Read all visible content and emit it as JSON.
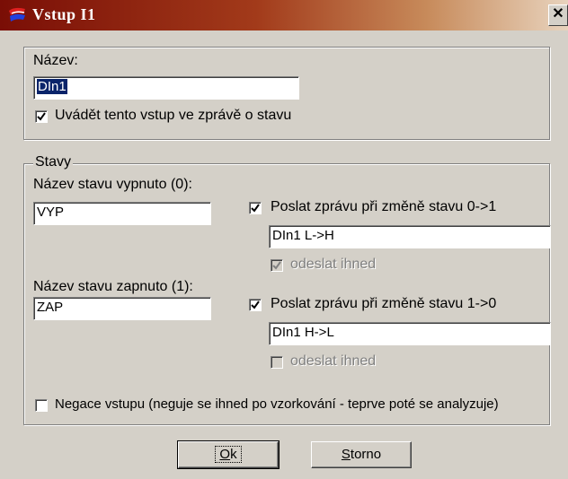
{
  "window": {
    "title": "Vstup I1",
    "close_glyph": "✕"
  },
  "name_section": {
    "label": "Název:",
    "value": "DIn1",
    "report_checkbox": {
      "label": "Uvádět tento vstup ve zprávě o stavu",
      "checked": true
    }
  },
  "states": {
    "legend": "Stavy",
    "off": {
      "label": "Název stavu vypnuto (0):",
      "value": "VYP",
      "send": {
        "label": "Poslat zprávu při změně stavu 0->1",
        "checked": true
      },
      "message": "DIn1 L->H",
      "immediate": {
        "label": "odeslat ihned",
        "checked": true,
        "disabled": true
      }
    },
    "on": {
      "label": "Název stavu zapnuto (1):",
      "value": "ZAP",
      "send": {
        "label": "Poslat zprávu při změně stavu 1->0",
        "checked": true
      },
      "message": "DIn1 H->L",
      "immediate": {
        "label": "odeslat ihned",
        "checked": false,
        "disabled": true
      }
    },
    "negate": {
      "label": "Negace vstupu (neguje se ihned po vzorkování - teprve poté se analyzuje)",
      "checked": false
    }
  },
  "buttons": {
    "ok_key": "O",
    "ok_rest": "k",
    "cancel_key": "S",
    "cancel_rest": "torno"
  },
  "colors": {
    "titlebar_start": "#7a0e06",
    "titlebar_end": "#e8d3bd",
    "face": "#d4d0c8",
    "selection": "#0a246a"
  }
}
